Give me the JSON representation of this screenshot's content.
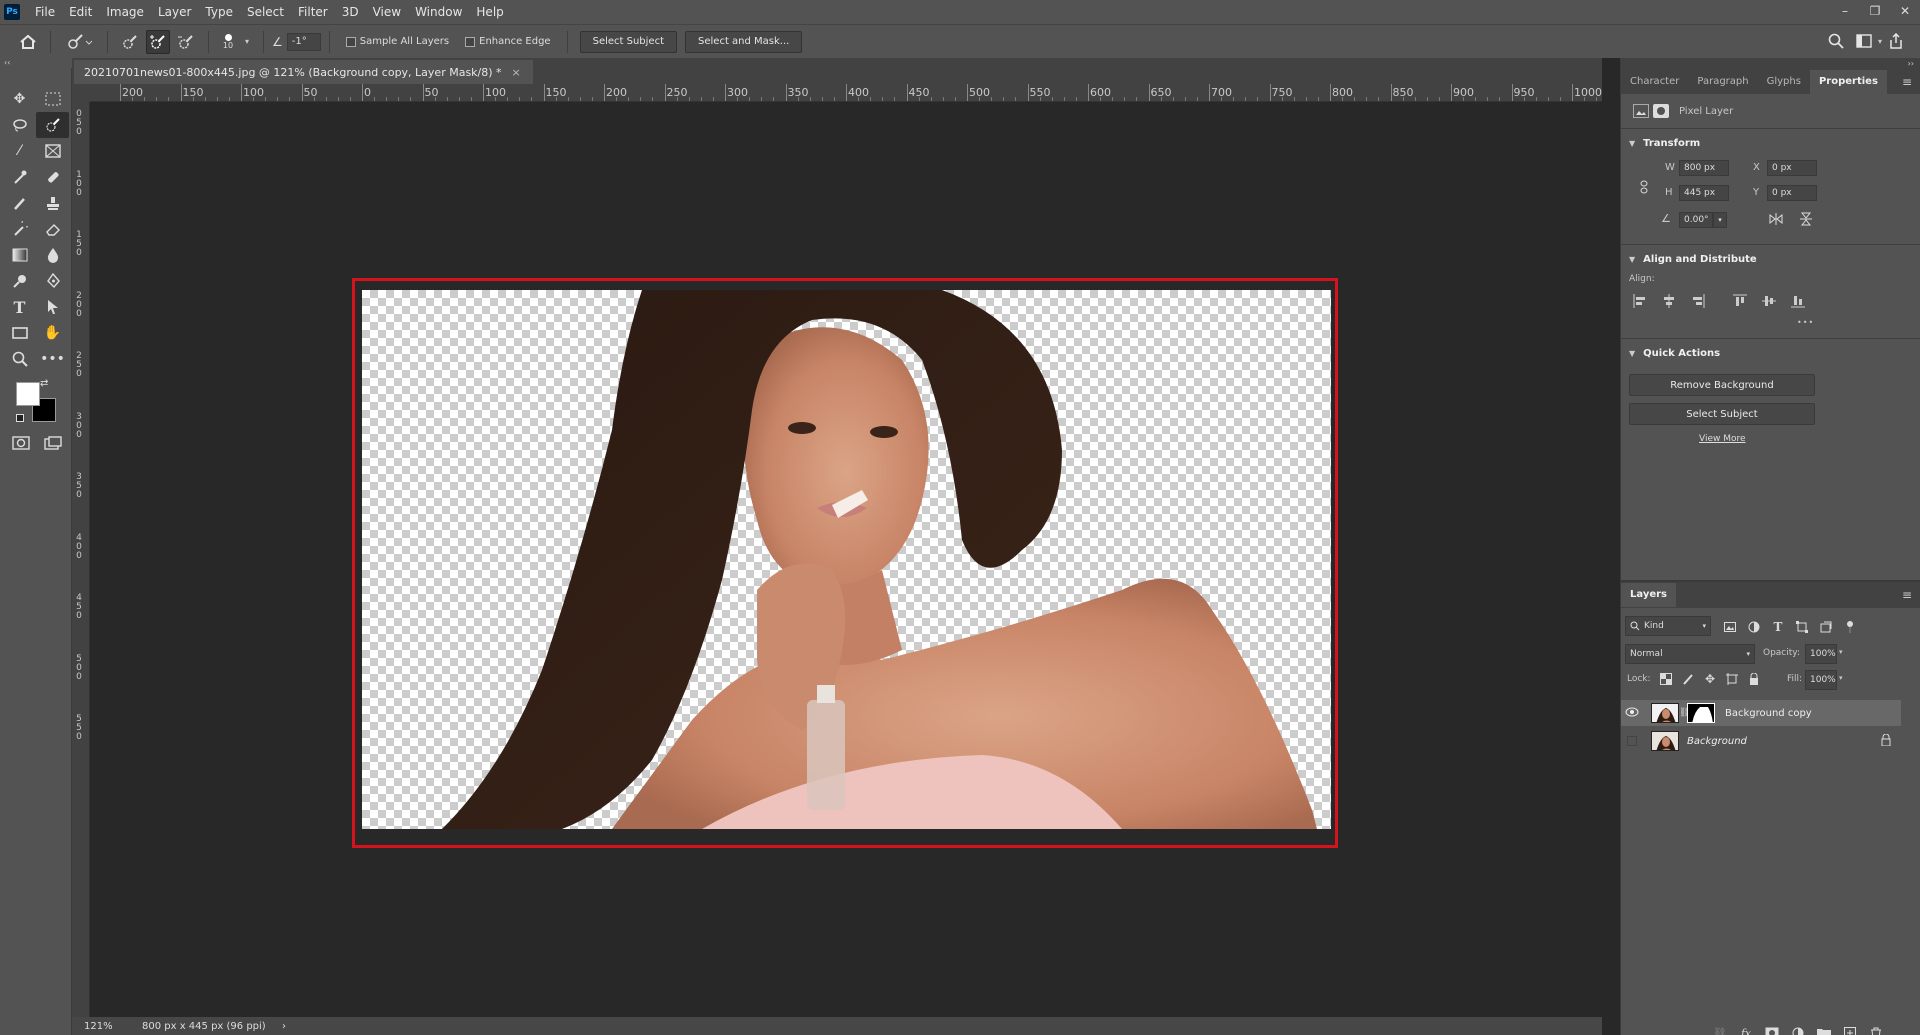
{
  "app": {
    "logo": "Ps"
  },
  "menu": [
    "File",
    "Edit",
    "Image",
    "Layer",
    "Type",
    "Select",
    "Filter",
    "3D",
    "View",
    "Window",
    "Help"
  ],
  "window_controls": [
    "–",
    "❐",
    "✕"
  ],
  "options_bar": {
    "brush_size": "10",
    "angle": "-1°",
    "sample_all_layers": "Sample All Layers",
    "enhance_edge": "Enhance Edge",
    "select_subject": "Select Subject",
    "select_and_mask": "Select and Mask..."
  },
  "document": {
    "tab_title": "20210701news01-800x445.jpg @ 121% (Background copy, Layer Mask/8) *",
    "close": "×"
  },
  "ruler_top": [
    "200",
    "150",
    "100",
    "50",
    "0",
    "50",
    "100",
    "150",
    "200",
    "250",
    "300",
    "350",
    "400",
    "450",
    "500",
    "550",
    "600",
    "650",
    "700",
    "750",
    "800",
    "850",
    "900",
    "950",
    "1000"
  ],
  "ruler_left": [
    "0",
    "5",
    "0",
    "1",
    "0",
    "0",
    "1",
    "5",
    "0",
    "2",
    "0",
    "0",
    "2",
    "5",
    "0",
    "3",
    "0",
    "0",
    "3",
    "5",
    "0",
    "4",
    "0",
    "0",
    "4",
    "5",
    "0",
    "5",
    "0",
    "0",
    "5",
    "5",
    "0"
  ],
  "status": {
    "zoom": "121%",
    "info": "800 px x 445 px (96 ppi)",
    "arrow": "›"
  },
  "colors": {
    "foreground": "#ffffff",
    "background": "#000000",
    "selection_outline": "#d4141c"
  },
  "properties_panel": {
    "tabs": [
      "Character",
      "Paragraph",
      "Glyphs",
      "Properties"
    ],
    "active_tab": "Properties",
    "layer_type": "Pixel Layer",
    "transform": {
      "title": "Transform",
      "w_label": "W",
      "w": "800 px",
      "h_label": "H",
      "h": "445 px",
      "x_label": "X",
      "x": "0 px",
      "y_label": "Y",
      "y": "0 px",
      "angle": "0.00°"
    },
    "align": {
      "title": "Align and Distribute",
      "label": "Align:",
      "more": "•••"
    },
    "quick_actions": {
      "title": "Quick Actions",
      "remove_background": "Remove Background",
      "select_subject": "Select Subject",
      "view_more": "View More"
    }
  },
  "layers_panel": {
    "title": "Layers",
    "filter": "Kind",
    "blend_mode": "Normal",
    "opacity_label": "Opacity:",
    "opacity": "100%",
    "lock_label": "Lock:",
    "fill_label": "Fill:",
    "fill": "100%",
    "layers": [
      {
        "name": "Background copy",
        "visible": true,
        "selected": true,
        "has_mask": true
      },
      {
        "name": "Background",
        "visible": false,
        "selected": false,
        "locked": true
      }
    ]
  }
}
